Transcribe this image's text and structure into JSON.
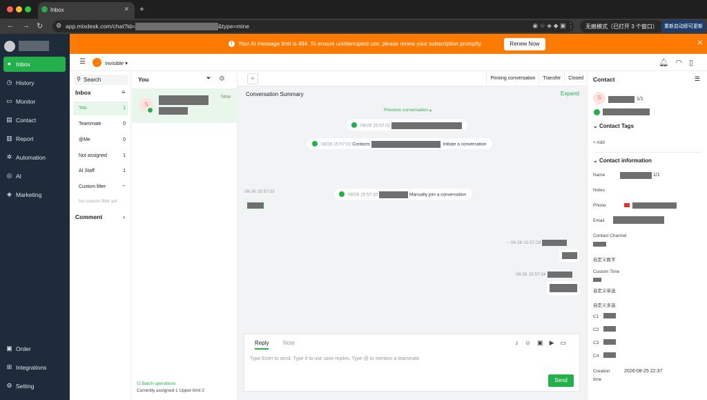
{
  "browser": {
    "tab_title": "Inbox",
    "url_prefix": "app.mixdesk.com/chat?id=",
    "url_suffix": "&type=mine",
    "incognito_label": "无痕模式（已打开 3 个窗口）",
    "relaunch_label": "重新启动即可更新"
  },
  "sidebar": {
    "items": [
      {
        "label": "Inbox",
        "icon": "chat-icon"
      },
      {
        "label": "History",
        "icon": "clock-icon"
      },
      {
        "label": "Monitor",
        "icon": "monitor-icon"
      },
      {
        "label": "Contact",
        "icon": "contact-card-icon"
      },
      {
        "label": "Report",
        "icon": "chart-icon"
      },
      {
        "label": "Automation",
        "icon": "gear-icon"
      },
      {
        "label": "AI",
        "icon": "ai-icon"
      },
      {
        "label": "Marketing",
        "icon": "megaphone-icon"
      }
    ],
    "bottom_items": [
      {
        "label": "Order",
        "icon": "briefcase-icon"
      },
      {
        "label": "Integrations",
        "icon": "grid-icon"
      },
      {
        "label": "Setting",
        "icon": "settings-icon"
      }
    ]
  },
  "banner": {
    "message": "Your AI message limit is 494. To ensure uninterrupted use, please renew your subscription promptly.",
    "renew_label": "Renew Now",
    "color": "#ff7a00"
  },
  "toolbar": {
    "status_label": "Invisible"
  },
  "inbox_panel": {
    "search_placeholder": "Search",
    "title": "Inbox",
    "rows": [
      {
        "label": "You",
        "count": "1"
      },
      {
        "label": "Teammate",
        "count": "0"
      },
      {
        "label": "@Me",
        "count": "0"
      },
      {
        "label": "Not assigned",
        "count": "1"
      },
      {
        "label": "AI Staff",
        "count": "1"
      }
    ],
    "custom_filter_label": "Custom filter",
    "custom_filter_empty": "No custom filter yet",
    "comment_label": "Comment"
  },
  "conversation_list": {
    "header": "You",
    "card": {
      "avatar_letter": "S",
      "time": "Now"
    },
    "batch_label": "Batch operations",
    "assigned_text": "Currently assigned 1 Upper limit 2"
  },
  "chat": {
    "actions": [
      "Pinning conversation",
      "Transfer",
      "Closed"
    ],
    "summary_label": "Conversation Summary",
    "expand_label": "Expand",
    "previous_label": "Previous conversation",
    "events": [
      {
        "time": "08/26 15:57:02",
        "text": ""
      },
      {
        "time": "08/26 15:57:02",
        "prefix": "Contacts",
        "text": ". Initiate a conversation"
      },
      {
        "time": "08/26 15:57:20",
        "text": "Manually join a conversation"
      }
    ],
    "left_msg_time": "08-26 15:57:03",
    "right_msgs": [
      {
        "time": "08-26 15:57:28"
      },
      {
        "time": "08-26 15:57:34"
      }
    ],
    "reply": {
      "tab_reply": "Reply",
      "tab_note": "Note",
      "placeholder": "Type Enter to send. Type # to use save replies. Type @ to mention a teammate",
      "send_label": "Send"
    }
  },
  "contact": {
    "title": "Contact",
    "avatar_letter": "S",
    "count_label": "1/1",
    "tags_label": "Contact Tags",
    "add_label": "Add",
    "info_label": "Contact information",
    "fields": {
      "name": "Name",
      "name_suffix": "1/1",
      "notes": "Notes",
      "phone": "Phone",
      "email": "Email",
      "channel": "Contact Channel",
      "custom_number": "自定义数字",
      "custom_time": "Custom Time",
      "single_select": "自定义单选",
      "multi_select": "自定义多选",
      "c1": "C1",
      "c2": "C2",
      "c3": "C3",
      "c4": "C4",
      "creation": "Creation",
      "time": "time",
      "creation_value": "2026-08-25 22:37"
    }
  },
  "colors": {
    "accent": "#23b04b",
    "nav_bg": "#1d2b3a",
    "banner": "#ff7a00"
  }
}
